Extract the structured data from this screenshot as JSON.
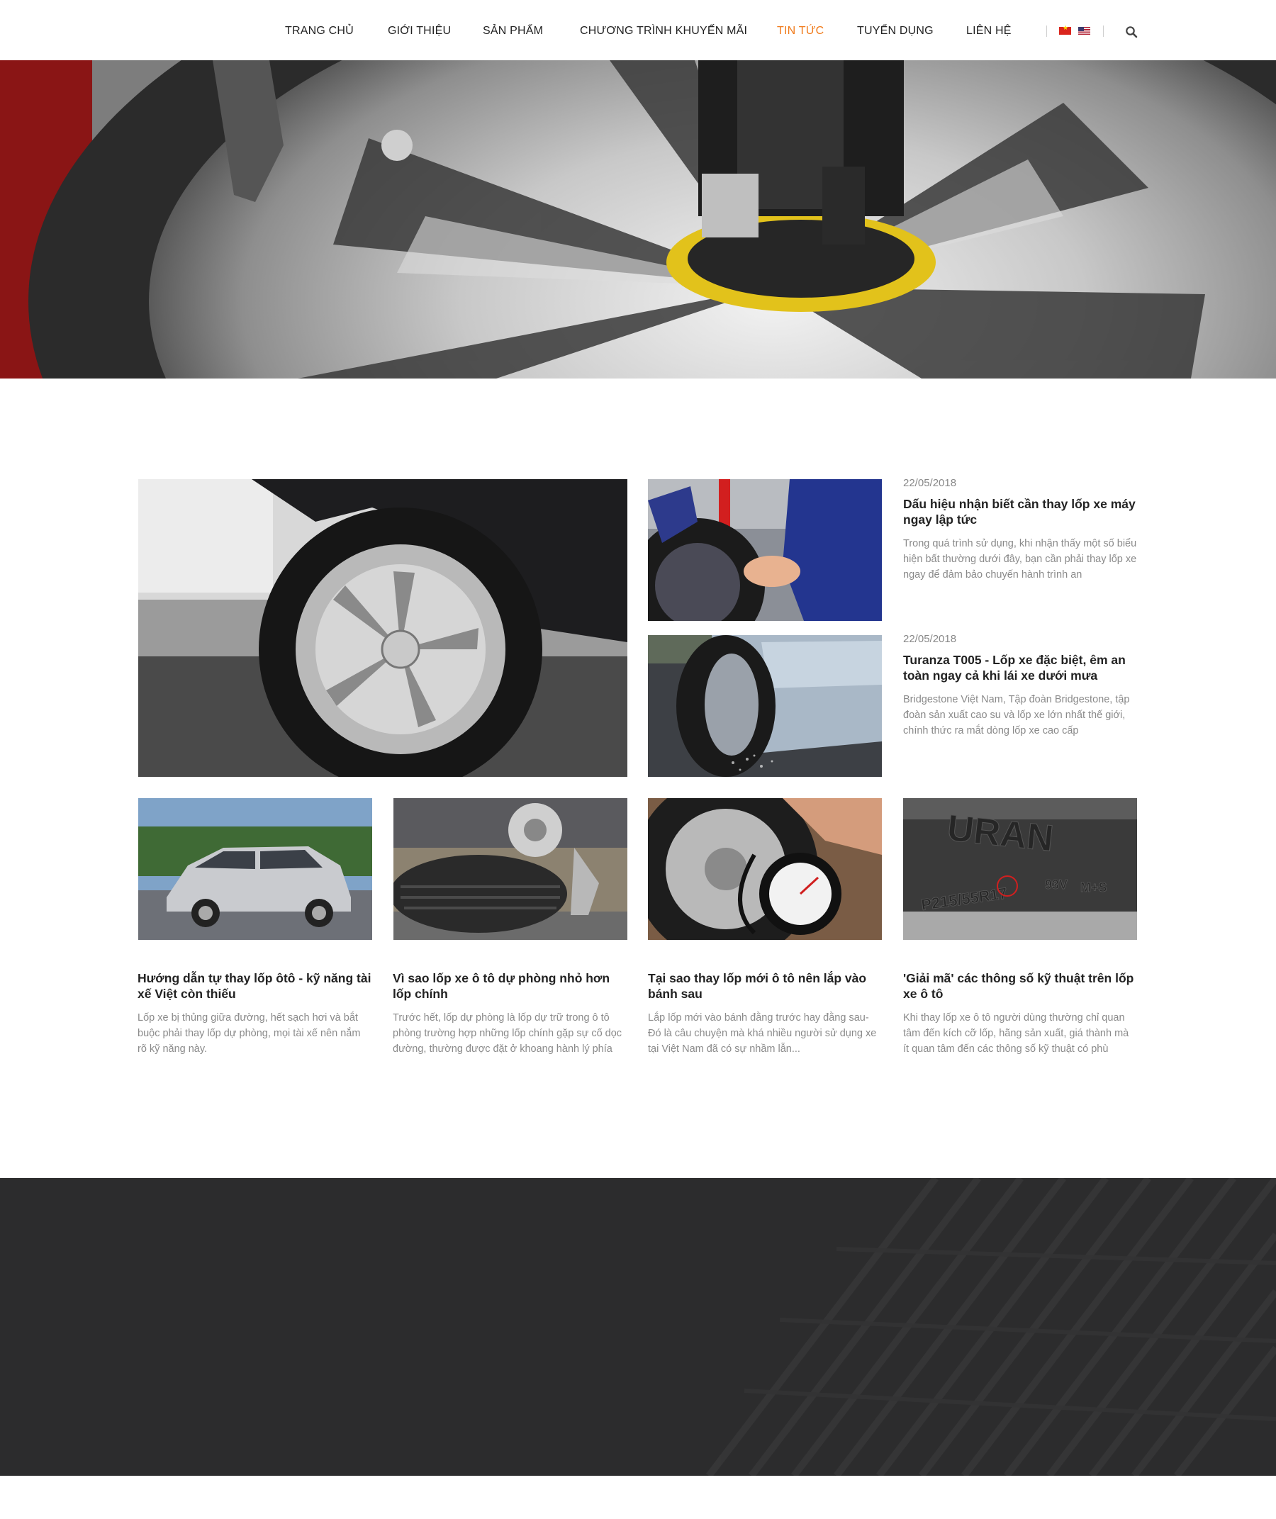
{
  "nav": {
    "items": [
      {
        "label": "TRANG CHỦ"
      },
      {
        "label": "GIỚI THIỆU"
      },
      {
        "label": "SẢN PHẨM"
      },
      {
        "label": "CHƯƠNG TRÌNH KHUYẾN MÃI"
      },
      {
        "label": "TIN TỨC"
      },
      {
        "label": "TUYỂN DỤNG"
      },
      {
        "label": "LIÊN HỆ"
      }
    ],
    "active_color": "#f07a1a",
    "languages": [
      "vn-flag-icon",
      "us-flag-icon"
    ],
    "search_icon": "search-icon"
  },
  "featured": [
    {
      "date": "22/05/2018",
      "title": "Dấu hiệu nhận biết cần thay lốp xe máy ngay lập tức",
      "excerpt": "Trong quá trình sử dụng, khi nhận thấy một số biểu hiện bất thường dưới đây, bạn cần phải thay lốp xe ngay để đảm bảo chuyến hành trình an"
    },
    {
      "date": "22/05/2018",
      "title": "Turanza T005 - Lốp xe đặc biệt, êm an toàn ngay cả khi lái xe dưới mưa",
      "excerpt": "Bridgestone Việt Nam, Tập đoàn Bridgestone, tập đoàn sản xuất cao su và lốp xe lớn nhất thế giới, chính thức ra mắt dòng lốp xe cao cấp"
    }
  ],
  "cards": [
    {
      "title": "Hướng dẫn tự thay lốp ôtô - kỹ năng tài xế Việt còn thiếu",
      "excerpt": "Lốp xe bị thủng giữa đường, hết sạch hơi và bắt buộc phải thay lốp dự phòng, mọi tài xế nên nắm rõ kỹ năng này."
    },
    {
      "title": "Vì sao lốp xe ô tô dự phòng nhỏ hơn lốp chính",
      "excerpt": "Trước hết, lốp dự phòng là lốp dự trữ trong ô tô phòng trường hợp những lốp chính gặp sự cố dọc đường, thường được đặt ở khoang hành lý phía"
    },
    {
      "title": "Tại sao thay lốp mới ô tô nên lắp vào bánh sau",
      "excerpt": "Lắp lốp mới vào bánh đằng trước hay đằng sau- Đó là câu chuyện mà khá nhiều người sử dụng xe tại Việt Nam đã có sự nhầm lẫn..."
    },
    {
      "title": "'Giải mã' các thông số kỹ thuật trên lốp xe ô tô",
      "excerpt": "Khi thay lốp xe ô tô người dùng thường chỉ quan tâm đến kích cỡ lốp, hãng sản xuất, giá thành mà ít quan tâm đến các thông số kỹ thuật có phù"
    }
  ],
  "tire_marking": {
    "brand": "URAN",
    "size": "P215/55R17",
    "load": "93V",
    "season": "M+S"
  }
}
